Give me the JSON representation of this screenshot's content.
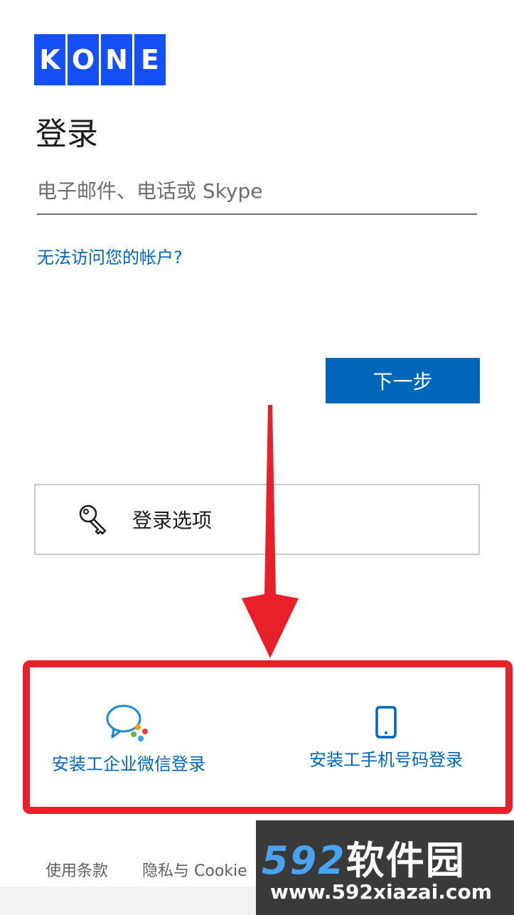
{
  "logo": {
    "letters": [
      "K",
      "O",
      "N",
      "E"
    ],
    "color": "#1450f5"
  },
  "title": "登录",
  "email": {
    "placeholder": "电子邮件、电话或 Skype",
    "value": ""
  },
  "links": {
    "cant_access": "无法访问您的帐户?"
  },
  "buttons": {
    "next": "下一步"
  },
  "signin_options": {
    "label": "登录选项",
    "icon": "key-icon"
  },
  "alt_login": {
    "wechat": {
      "label": "安装工企业微信登录",
      "icon": "wechat-work-icon"
    },
    "phone": {
      "label": "安装工手机号码登录",
      "icon": "mobile-phone-icon"
    }
  },
  "footer": {
    "terms": "使用条款",
    "privacy": "隐私与 Cookie"
  },
  "watermark": {
    "brand_number": "592",
    "brand_cn": "软件园",
    "url": "www.592xiazai.com"
  },
  "colors": {
    "accent": "#0067b8",
    "annotation": "#e8202a",
    "logo": "#1450f5"
  }
}
